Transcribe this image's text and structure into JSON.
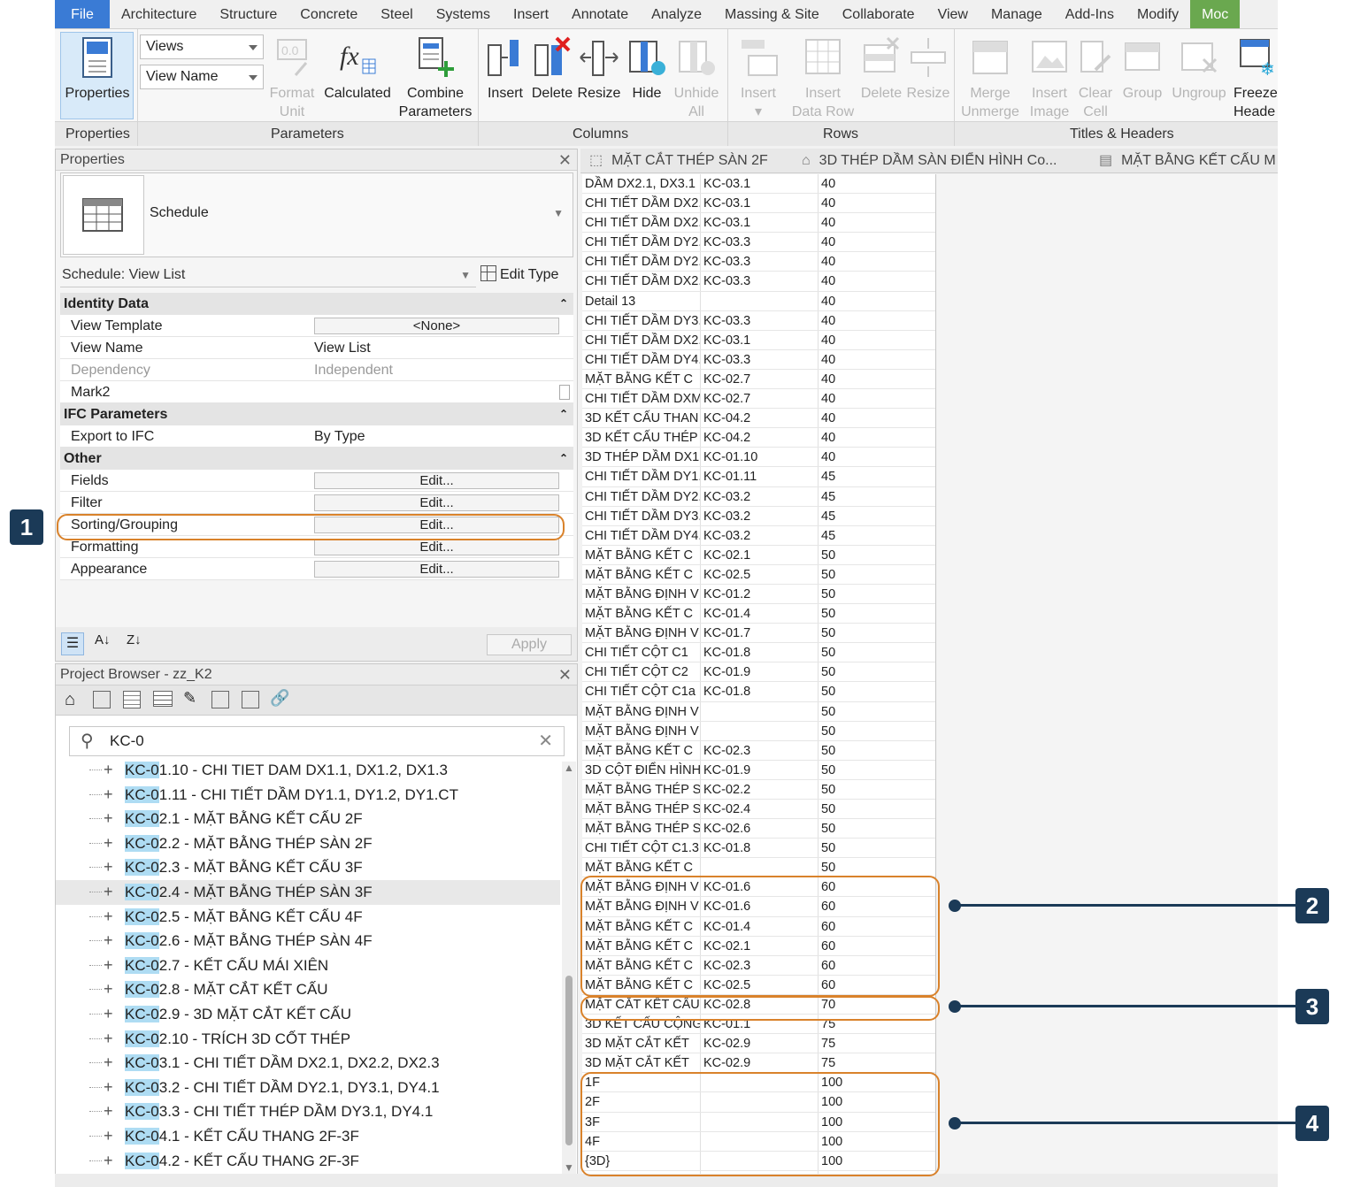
{
  "menu": [
    "Architecture",
    "Structure",
    "Concrete",
    "Steel",
    "Systems",
    "Insert",
    "Annotate",
    "Analyze",
    "Massing & Site",
    "Collaborate",
    "View",
    "Manage",
    "Add-Ins",
    "Modify",
    "Moc"
  ],
  "file_label": "File",
  "ribbon": {
    "properties_btn": "Properties",
    "views_combo": "Views",
    "viewname_combo": "View Name",
    "format_unit": [
      "Format",
      "Unit"
    ],
    "calculated": "Calculated",
    "combine": [
      "Combine",
      "Parameters"
    ],
    "insert": "Insert",
    "delete": "Delete",
    "resize": "Resize",
    "hide": "Hide",
    "unhide": [
      "Unhide",
      "All"
    ],
    "rows_insert": "Insert",
    "insert_data_row": [
      "Insert",
      "Data Row"
    ],
    "rows_delete": "Delete",
    "rows_resize": "Resize",
    "merge": [
      "Merge",
      "Unmerge"
    ],
    "insert_image": [
      "Insert",
      "Image"
    ],
    "clear_cell": [
      "Clear",
      "Cell"
    ],
    "group": "Group",
    "ungroup": "Ungroup",
    "freeze": [
      "Freeze",
      "Heade"
    ],
    "panels": [
      "Properties",
      "Parameters",
      "Columns",
      "Rows",
      "Titles & Headers"
    ]
  },
  "properties": {
    "title": "Properties",
    "type_name": "Schedule",
    "selector": "Schedule: View List",
    "edit_type": "Edit Type",
    "groups": {
      "identity": "Identity Data",
      "ifc": "IFC Parameters",
      "other": "Other"
    },
    "rows": {
      "view_template": [
        "View Template",
        "<None>"
      ],
      "view_name": [
        "View Name",
        "View List"
      ],
      "dependency": [
        "Dependency",
        "Independent"
      ],
      "mark2": [
        "Mark2",
        ""
      ],
      "export_ifc": [
        "Export to IFC",
        "By Type"
      ],
      "fields": [
        "Fields",
        "Edit..."
      ],
      "filter": [
        "Filter",
        "Edit..."
      ],
      "sorting": [
        "Sorting/Grouping",
        "Edit..."
      ],
      "formatting": [
        "Formatting",
        "Edit..."
      ],
      "appearance": [
        "Appearance",
        "Edit..."
      ]
    },
    "apply": "Apply"
  },
  "browser": {
    "title": "Project Browser - zz_K2",
    "search": "KC-0",
    "items": [
      [
        "KC-0",
        "1.10 - CHI TIET DAM DX1.1, DX1.2, DX1.3"
      ],
      [
        "KC-0",
        "1.11 - CHI TIẾT DẦM DY1.1, DY1.2, DY1.CT"
      ],
      [
        "KC-0",
        "2.1 - MẶT BẰNG KẾT CẤU 2F"
      ],
      [
        "KC-0",
        "2.2 - MẶT BẰNG THÉP SÀN 2F"
      ],
      [
        "KC-0",
        "2.3 - MẶT BẰNG KẾT CẤU 3F"
      ],
      [
        "KC-0",
        "2.4 - MẶT BẰNG THÉP SÀN 3F"
      ],
      [
        "KC-0",
        "2.5 - MẶT BẰNG KẾT CẤU 4F"
      ],
      [
        "KC-0",
        "2.6 - MẶT BẰNG THÉP SÀN 4F"
      ],
      [
        "KC-0",
        "2.7 - KẾT CẤU MÁI XIÊN"
      ],
      [
        "KC-0",
        "2.8 - MẶT CẮT KẾT CẤU"
      ],
      [
        "KC-0",
        "2.9 - 3D MẶT CẮT KẾT CẤU"
      ],
      [
        "KC-0",
        "2.10 - TRÍCH 3D CỐT THÉP"
      ],
      [
        "KC-0",
        "3.1 - CHI TIẾT DẦM DX2.1, DX2.2, DX2.3"
      ],
      [
        "KC-0",
        "3.2 - CHI TIẾT DẦM DY2.1, DY3.1, DY4.1"
      ],
      [
        "KC-0",
        "3.3 - CHI TIẾT THÉP DẦM DY3.1, DY4.1"
      ],
      [
        "KC-0",
        "4.1 - KẾT CẤU THANG 2F-3F"
      ],
      [
        "KC-0",
        "4.2 - KẾT CẤU THANG 2F-3F"
      ]
    ]
  },
  "tabs": [
    "MẶT CẮT THÉP SÀN 2F",
    "3D THÉP DẦM SÀN ĐIỂN HÌNH Co...",
    "MẶT BẰNG KẾT CẤU M"
  ],
  "schedule": [
    [
      "DẦM DX2.1, DX3.1",
      "KC-03.1",
      "40"
    ],
    [
      "CHI TIẾT DẦM DX2.",
      "KC-03.1",
      "40"
    ],
    [
      "CHI TIẾT DẦM DX2.",
      "KC-03.1",
      "40"
    ],
    [
      "CHI TIẾT DẦM DY2.",
      "KC-03.3",
      "40"
    ],
    [
      "CHI TIẾT DẦM DY2.",
      "KC-03.3",
      "40"
    ],
    [
      "CHI TIẾT DẦM DX2.",
      "KC-03.3",
      "40"
    ],
    [
      "Detail 13",
      "",
      "40"
    ],
    [
      "CHI TIẾT DẦM DY3.",
      "KC-03.3",
      "40"
    ],
    [
      "CHI TIẾT DẦM DX2.",
      "KC-03.1",
      "40"
    ],
    [
      "CHI TIẾT DẦM DY4.",
      "KC-03.3",
      "40"
    ],
    [
      "MẶT BẰNG KẾT C",
      "KC-02.7",
      "40"
    ],
    [
      "CHI TIẾT DẦM DXM.",
      "KC-02.7",
      "40"
    ],
    [
      "3D KẾT CẤU THAN",
      "KC-04.2",
      "40"
    ],
    [
      "3D KẾT CẤU THÉP",
      "KC-04.2",
      "40"
    ],
    [
      "3D THÉP DẦM DX1.",
      "KC-01.10",
      "40"
    ],
    [
      "CHI TIẾT DẦM DY1.",
      "KC-01.11",
      "45"
    ],
    [
      "CHI TIẾT DẦM DY2.",
      "KC-03.2",
      "45"
    ],
    [
      "CHI TIẾT DẦM DY3.",
      "KC-03.2",
      "45"
    ],
    [
      "CHI TIẾT DẦM DY4.",
      "KC-03.2",
      "45"
    ],
    [
      "MẶT BẰNG KẾT C",
      "KC-02.1",
      "50"
    ],
    [
      "MẶT BẰNG KẾT C",
      "KC-02.5",
      "50"
    ],
    [
      "MẶT BẰNG ĐỊNH V",
      "KC-01.2",
      "50"
    ],
    [
      "MẶT BẰNG KẾT C",
      "KC-01.4",
      "50"
    ],
    [
      "MẶT BẰNG ĐỊNH V",
      "KC-01.7",
      "50"
    ],
    [
      "CHI TIẾT CỘT C1",
      "KC-01.8",
      "50"
    ],
    [
      "CHI TIẾT CỘT C2",
      "KC-01.9",
      "50"
    ],
    [
      "CHI TIẾT CỘT C1a",
      "KC-01.8",
      "50"
    ],
    [
      "MẶT BẰNG ĐỊNH V",
      "",
      "50"
    ],
    [
      "MẶT BẰNG ĐỊNH V",
      "",
      "50"
    ],
    [
      "MẶT BẰNG KẾT C",
      "KC-02.3",
      "50"
    ],
    [
      "3D CỘT ĐIỂN HÌNH",
      "KC-01.9",
      "50"
    ],
    [
      "MẶT BẰNG THÉP S",
      "KC-02.2",
      "50"
    ],
    [
      "MẶT BẰNG THÉP S",
      "KC-02.4",
      "50"
    ],
    [
      "MẶT BẰNG THÉP S",
      "KC-02.6",
      "50"
    ],
    [
      "CHI TIẾT CỘT C1.3",
      "KC-01.8",
      "50"
    ],
    [
      "MẶT BẰNG KẾT C",
      "",
      "50"
    ],
    [
      "MẶT BẰNG ĐỊNH V",
      "KC-01.6",
      "60"
    ],
    [
      "MẶT BẰNG ĐỊNH V",
      "KC-01.6",
      "60"
    ],
    [
      "MẶT BẰNG KẾT C",
      "KC-01.4",
      "60"
    ],
    [
      "MẶT BẰNG KẾT C",
      "KC-02.1",
      "60"
    ],
    [
      "MẶT BẰNG KẾT C",
      "KC-02.3",
      "60"
    ],
    [
      "MẶT BẰNG KẾT C",
      "KC-02.5",
      "60"
    ],
    [
      "MẶT CẮT KẾT CẤU",
      "KC-02.8",
      "70"
    ],
    [
      "3D KẾT CẤU CỘNG",
      "KC-01.1",
      "75"
    ],
    [
      "3D MẶT CẮT KẾT",
      "KC-02.9",
      "75"
    ],
    [
      "3D MẶT CẮT KẾT",
      "KC-02.9",
      "75"
    ],
    [
      "1F",
      "",
      "100"
    ],
    [
      "2F",
      "",
      "100"
    ],
    [
      "3F",
      "",
      "100"
    ],
    [
      "4F",
      "",
      "100"
    ],
    [
      "{3D}",
      "",
      "100"
    ]
  ],
  "callouts": [
    "1",
    "2",
    "3",
    "4"
  ],
  "colors": {
    "accent": "#3a7bd5",
    "callout_box": "#d9822b",
    "badge": "#1b3a57",
    "highlight": "#aedcf3"
  }
}
